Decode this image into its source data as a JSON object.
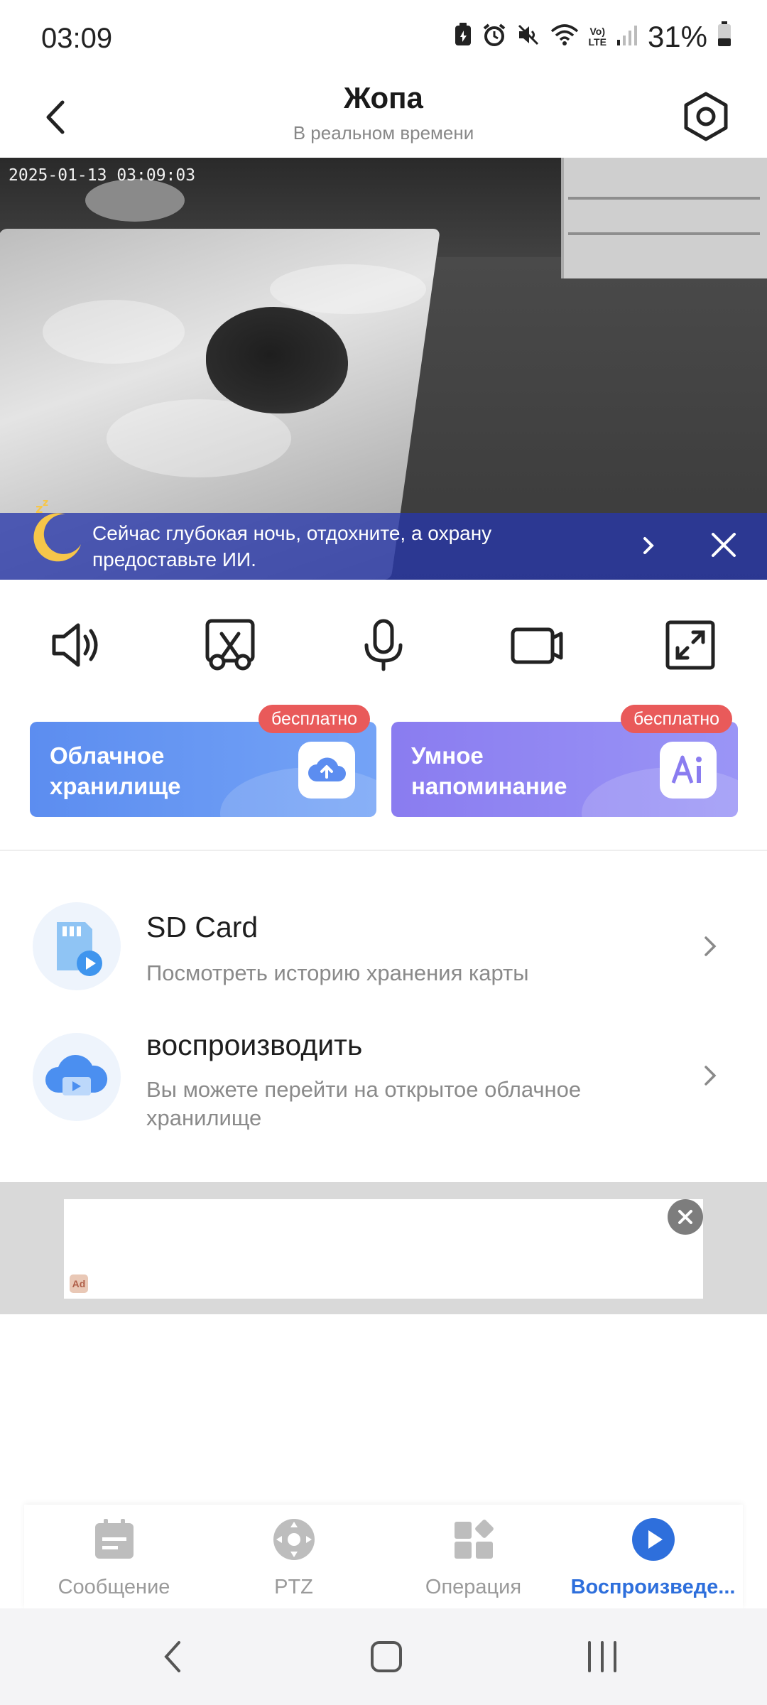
{
  "status_bar": {
    "time": "03:09",
    "battery": "31%",
    "net_label_top": "Vo)",
    "net_label_bottom": "LTE"
  },
  "header": {
    "title": "Жопа",
    "subtitle": "В реальном времени"
  },
  "video": {
    "timestamp": "2025-01-13 03:09:03",
    "banner_text": "Сейчас глубокая ночь, отдохните, а охрану предоставьте ИИ."
  },
  "controls": [
    "speaker-icon",
    "screenshot-icon",
    "microphone-icon",
    "record-icon",
    "fullscreen-icon"
  ],
  "cards": [
    {
      "label_line1": "Облачное",
      "label_line2": "хранилище",
      "badge": "бесплатно",
      "color": "#5c8df0"
    },
    {
      "label_line1": "Умное",
      "label_line2": "напоминание",
      "badge": "бесплатно",
      "color": "#8a7cf0"
    }
  ],
  "list": [
    {
      "title": "SD Card",
      "subtitle": "Посмотреть историю хранения карты"
    },
    {
      "title": "воспроизводить",
      "subtitle": "Вы можете перейти на открытое облачное хранилище"
    }
  ],
  "ad": {
    "logo": "Ad"
  },
  "bottom_nav": [
    {
      "label": "Сообщение",
      "icon": "message-icon",
      "active": false
    },
    {
      "label": "PTZ",
      "icon": "ptz-icon",
      "active": false
    },
    {
      "label": "Операция",
      "icon": "operation-icon",
      "active": false
    },
    {
      "label": "Воспроизведе...",
      "icon": "playback-icon",
      "active": true
    }
  ],
  "colors": {
    "accent": "#2e6fdc",
    "badge": "#e95a5a",
    "banner": "#2837aa"
  }
}
